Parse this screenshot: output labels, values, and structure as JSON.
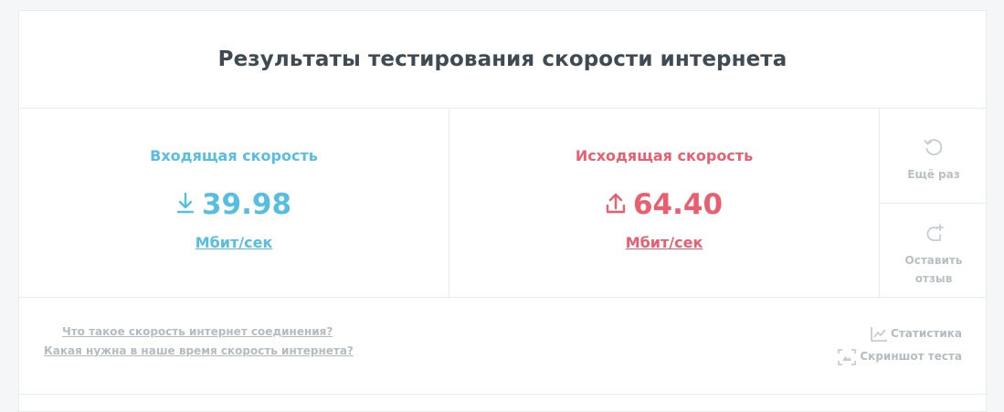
{
  "title": "Результаты тестирования скорости интернета",
  "download": {
    "label": "Входящая скорость",
    "value": "39.98",
    "unit": "Мбит/сек",
    "color": "#56bfe0"
  },
  "upload": {
    "label": "Исходящая скорость",
    "value": "64.40",
    "unit": "Мбит/сек",
    "color": "#ea5f6f"
  },
  "actions": {
    "retry_label": "Ещё раз",
    "review_label_1": "Оставить",
    "review_label_2": "отзыв"
  },
  "faq": [
    "Что такое скорость интернет соединения?",
    "Какая нужна в наше время скорость интернета?"
  ],
  "tools": {
    "stats_label": "Статистика",
    "screenshot_label": "Скриншот теста"
  }
}
